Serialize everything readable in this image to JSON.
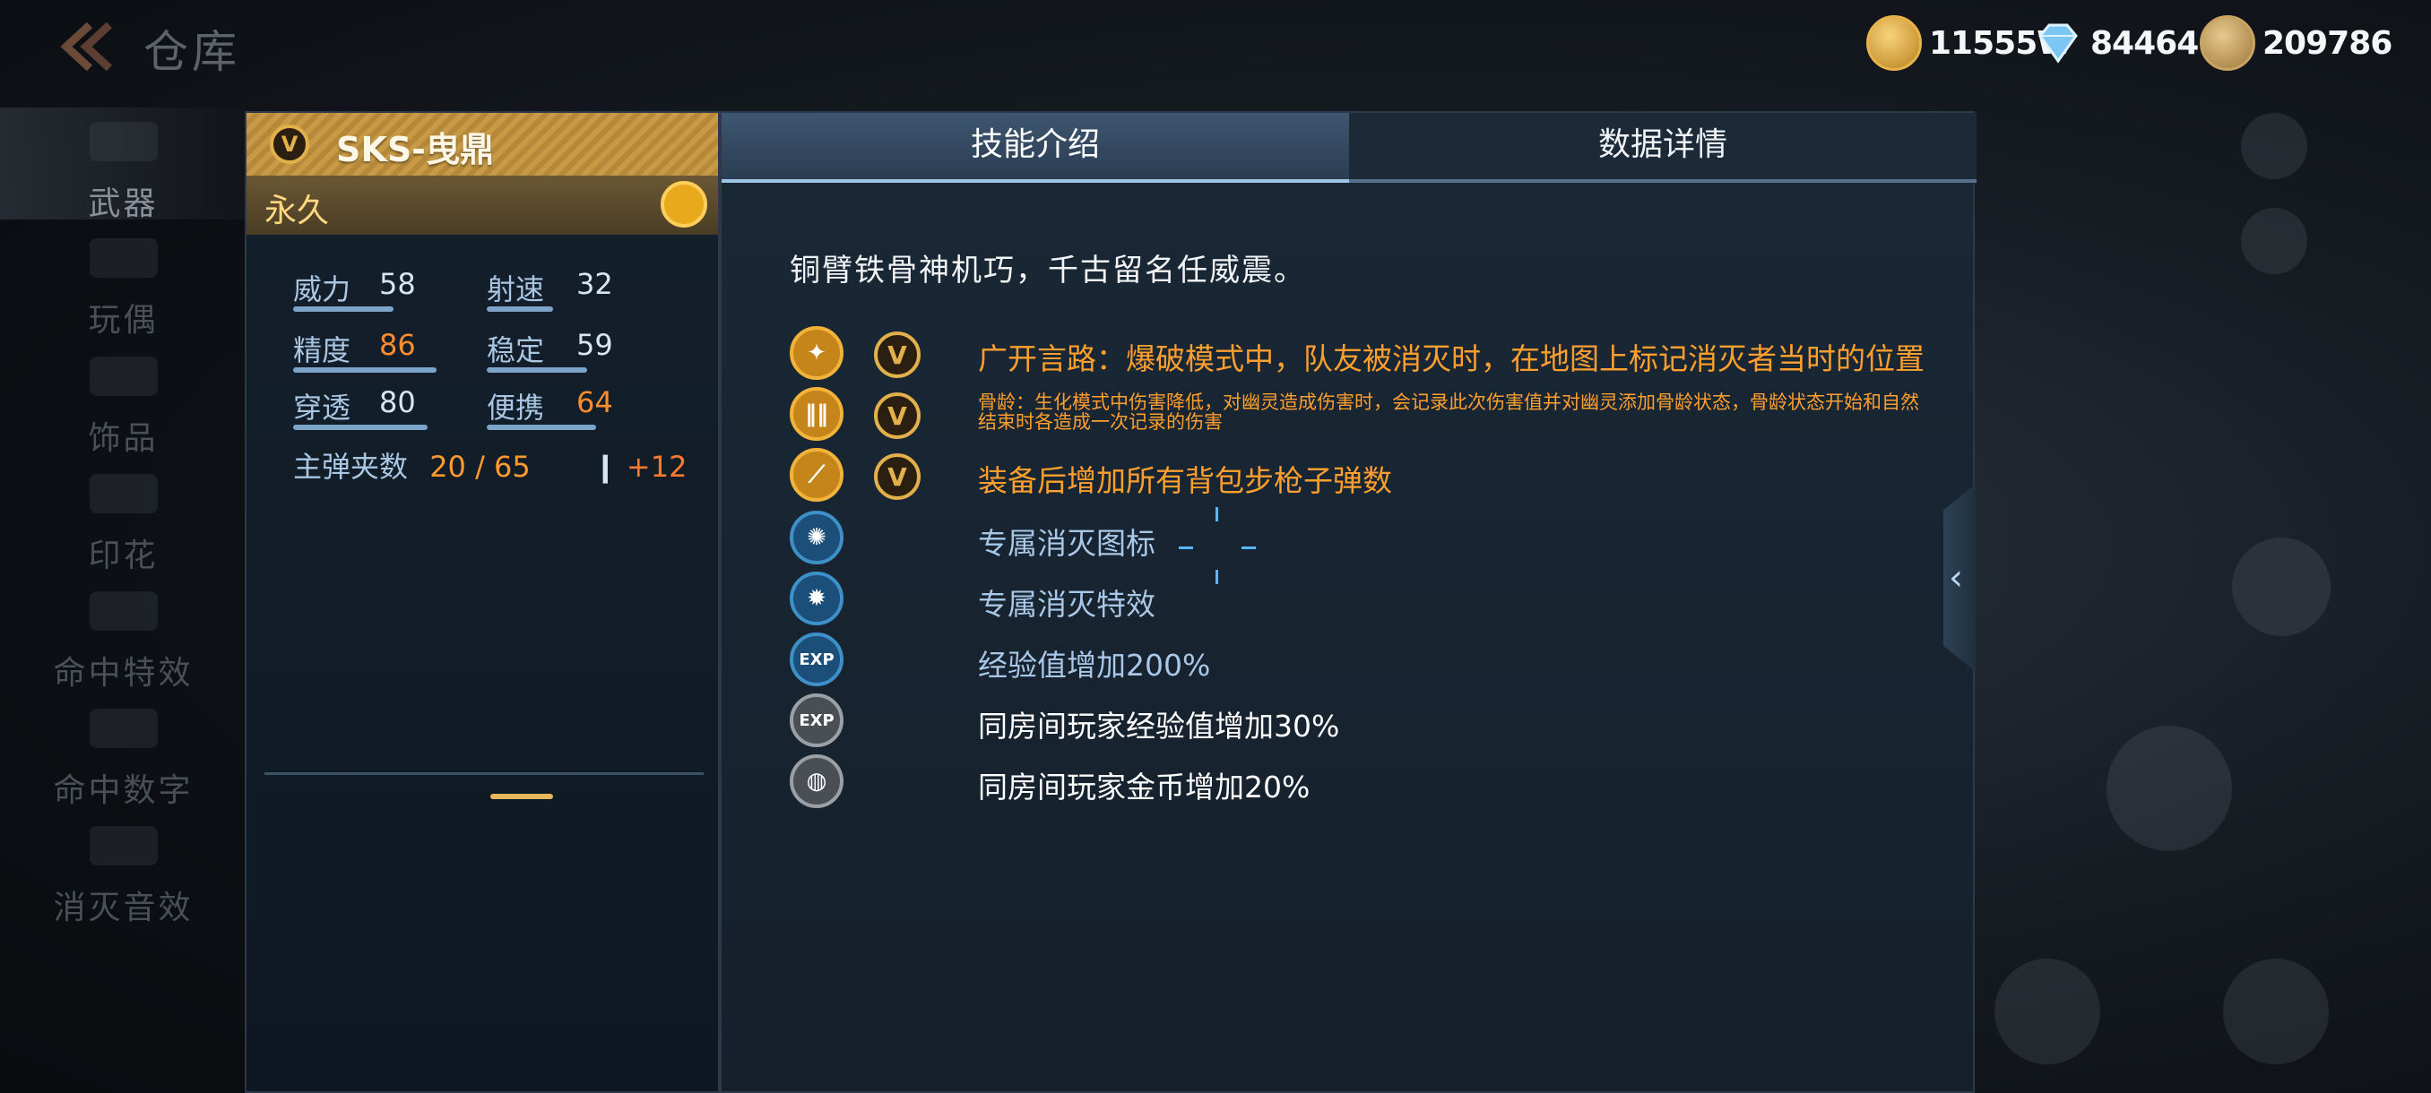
{
  "header": {
    "title": "仓库",
    "currencies": [
      {
        "icon": "gold-coin-icon",
        "value": "11555W"
      },
      {
        "icon": "diamond-icon",
        "value": "84464"
      },
      {
        "icon": "token-icon",
        "value": "209786"
      }
    ]
  },
  "sidebar": {
    "items": [
      {
        "label": "武器"
      },
      {
        "label": "玩偶"
      },
      {
        "label": "饰品"
      },
      {
        "label": "印花"
      },
      {
        "label": "命中特效"
      },
      {
        "label": "命中数字"
      },
      {
        "label": "消灭音效"
      }
    ]
  },
  "weapon": {
    "name": "SKS-曳鼎",
    "badge": "V",
    "duration": "永久",
    "stats": [
      {
        "label": "威力",
        "value": "58"
      },
      {
        "label": "射速",
        "value": "32"
      },
      {
        "label": "精度",
        "value": "86"
      },
      {
        "label": "稳定",
        "value": "59"
      },
      {
        "label": "穿透",
        "value": "80"
      },
      {
        "label": "便携",
        "value": "64"
      }
    ],
    "ammo_label": "主弹夹数",
    "ammo_value": "20 / 65",
    "ammo_bonus": "+12"
  },
  "skill_panel": {
    "tabs": [
      {
        "label": "技能介绍",
        "active": true
      },
      {
        "label": "数据详情",
        "active": false
      }
    ],
    "description": "铜臂铁骨神机巧，千古留名任威震。",
    "skills": [
      {
        "icon": "running-man-icon",
        "text": "广开言路：爆破模式中，队友被消灭时，在地图上标记消灭者当时的位置"
      },
      {
        "icon": "bullets-icon",
        "text": "骨龄：生化模式中伤害降低，对幽灵造成伤害时，会记录此次伤害值并对幽灵添加骨龄状态，骨龄状态开始和自然结束时各造成一次记录的伤害"
      },
      {
        "icon": "rifle-icon",
        "text": "装备后增加所有背包步枪子弹数"
      },
      {
        "icon": "kill-icon-emblem",
        "text": "专属消灭图标"
      },
      {
        "icon": "kill-effect-icon",
        "text": "专属消灭特效"
      },
      {
        "icon": "exp-icon",
        "text": "经验值增加200%"
      },
      {
        "icon": "room-exp-icon",
        "text": "同房间玩家经验值增加30%"
      },
      {
        "icon": "room-gold-icon",
        "text": "同房间玩家金币增加20%"
      }
    ],
    "exp_glyph": "EXP"
  },
  "colors": {
    "gold": "#e3b04b",
    "orange": "#ff9f2e",
    "blue_text": "#a9c8e8",
    "panel_bg": "#1a2836"
  }
}
